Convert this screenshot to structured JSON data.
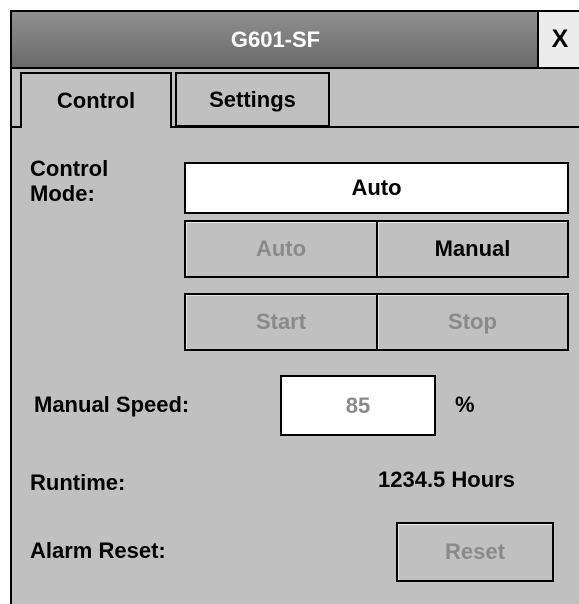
{
  "window": {
    "title": "G601-SF",
    "close_label": "X"
  },
  "tabs": [
    {
      "label": "Control",
      "active": true
    },
    {
      "label": "Settings",
      "active": false
    }
  ],
  "control": {
    "mode_label_line1": "Control",
    "mode_label_line2": "Mode:",
    "mode_value": "Auto",
    "auto_button": "Auto",
    "manual_button": "Manual",
    "start_button": "Start",
    "stop_button": "Stop",
    "speed_label": "Manual Speed:",
    "speed_value": "85",
    "speed_unit": "%",
    "runtime_label": "Runtime:",
    "runtime_value": "1234.5 Hours",
    "alarm_label": "Alarm Reset:",
    "reset_button": "Reset"
  },
  "colors": {
    "panel": "#c0c0c0",
    "titlebar": "#6a6a6a",
    "disabled_text": "#8a8a8a"
  }
}
